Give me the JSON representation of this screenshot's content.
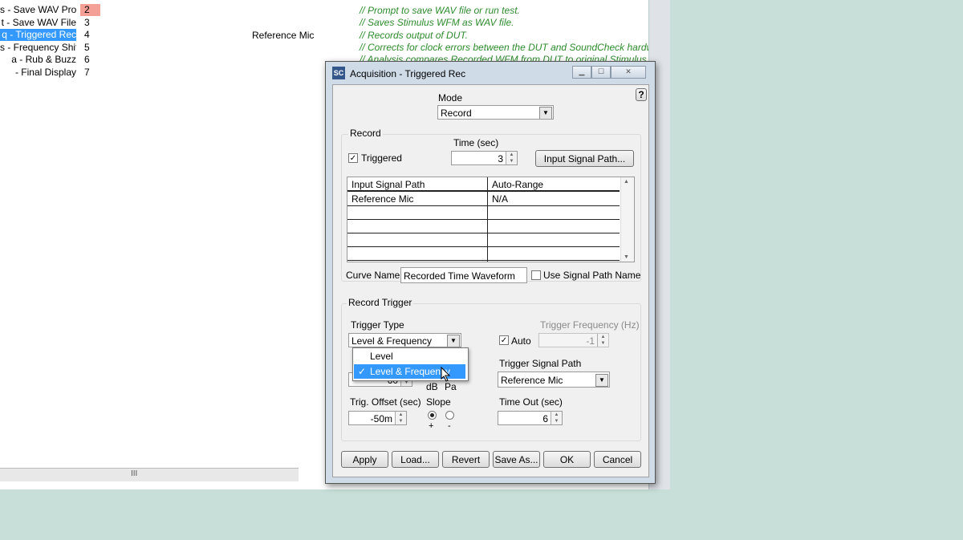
{
  "sequence": {
    "rows": [
      {
        "name": "s - Save WAV Pror",
        "num": "2",
        "hl_num": true,
        "selected": false
      },
      {
        "name": "t - Save WAV File",
        "num": "3",
        "hl_num": false,
        "selected": false
      },
      {
        "name": "q - Triggered Rec",
        "num": "4",
        "hl_num": false,
        "selected": true
      },
      {
        "name": "s - Frequency Shift",
        "num": "5",
        "hl_num": false,
        "selected": false
      },
      {
        "name": "a - Rub & Buzz",
        "num": "6",
        "hl_num": false,
        "selected": false
      },
      {
        "name": "- Final Display",
        "num": "7",
        "hl_num": false,
        "selected": false
      }
    ],
    "input_col": "Reference Mic",
    "comments": [
      "// Prompt to save WAV file or run test.",
      "// Saves Stimulus WFM as WAV file.",
      "// Records output of DUT.",
      "// Corrects for clock errors between the DUT and SoundCheck hardware",
      "// Analysis compares Recorded WFM from DUT to original Stimulus WF"
    ],
    "hscroll_grip": "III"
  },
  "dialog": {
    "logo": "SC",
    "title": "Acquisition  - Triggered Rec",
    "help_label": "?",
    "mode": {
      "label": "Mode",
      "value": "Record"
    },
    "record": {
      "group_label": "Record",
      "triggered_label": "Triggered",
      "triggered_checked": true,
      "time_label": "Time (sec)",
      "time_value": "3",
      "input_signal_path_button": "Input Signal Path...",
      "table": {
        "headers": [
          "Input Signal Path",
          "Auto-Range"
        ],
        "rows": [
          [
            "Reference Mic",
            "N/A"
          ],
          [
            "",
            ""
          ],
          [
            "",
            ""
          ],
          [
            "",
            ""
          ],
          [
            "",
            ""
          ]
        ]
      },
      "curve_name_label": "Curve Name",
      "curve_name_value": "Recorded Time Waveform",
      "use_signal_path_name_label": "Use Signal Path Name",
      "use_signal_path_name_checked": false
    },
    "trigger": {
      "group_label": "Record Trigger",
      "trigger_type_label": "Trigger Type",
      "trigger_type_value": "Level & Frequency",
      "trigger_type_options": [
        "Level",
        "Level & Frequency"
      ],
      "check_mark": "✓",
      "level_value_partial": "60",
      "unit_db": "dB",
      "unit_pa": "Pa",
      "trigger_frequency_label": "Trigger Frequency (Hz)",
      "auto_label": "Auto",
      "auto_checked": true,
      "trigger_frequency_value": "-1",
      "trigger_signal_path_label": "Trigger Signal Path",
      "trigger_signal_path_value": "Reference Mic",
      "trig_offset_label": "Trig. Offset (sec)",
      "trig_offset_value": "-50m",
      "slope_label": "Slope",
      "slope_plus": "+",
      "slope_minus": "-",
      "time_out_label": "Time Out (sec)",
      "time_out_value": "6"
    },
    "buttons": {
      "apply": "Apply",
      "load": "Load...",
      "revert": "Revert",
      "save_as": "Save As...",
      "ok": "OK",
      "cancel": "Cancel"
    }
  }
}
